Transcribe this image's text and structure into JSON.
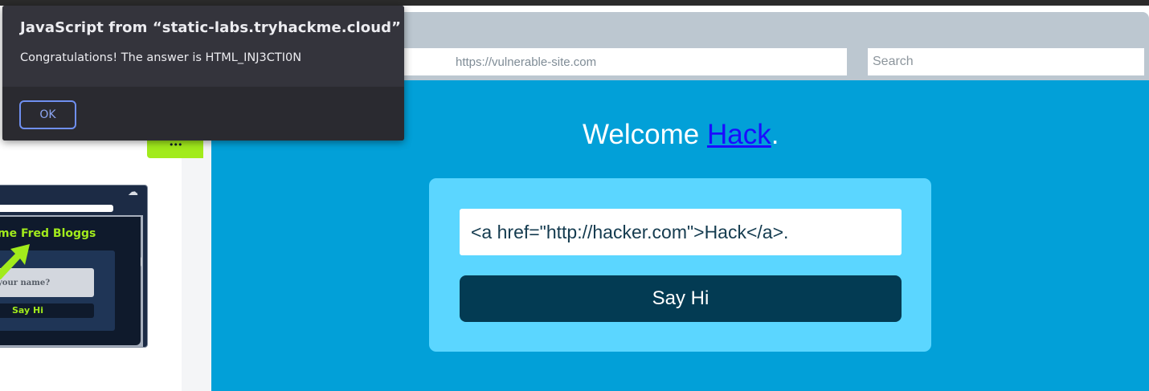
{
  "dialog": {
    "title": "JavaScript from “static-labs.tryhackme.cloud”",
    "message": "Congratulations! The answer is HTML_INJ3CTI0N",
    "ok_label": "OK"
  },
  "left_panel": {
    "tab_dots": "•••",
    "illustration": {
      "heading": "me Fred Bloggs",
      "input_placeholder": "your name?",
      "button_label": "Say Hi",
      "cloud_icon": "☁"
    }
  },
  "browser": {
    "url": "https://vulnerable-site.com",
    "search_placeholder": "Search"
  },
  "site": {
    "welcome_prefix": "Welcome ",
    "welcome_link": "Hack",
    "welcome_suffix": ".",
    "name_input_value": "<a href=\"http://hacker.com\">Hack</a>.",
    "say_hi_label": "Say Hi"
  },
  "colors": {
    "site_background": "#02a0d8",
    "card_background": "#5bd6ff",
    "button_background": "#033b53",
    "accent_green": "#a2eb1c"
  }
}
